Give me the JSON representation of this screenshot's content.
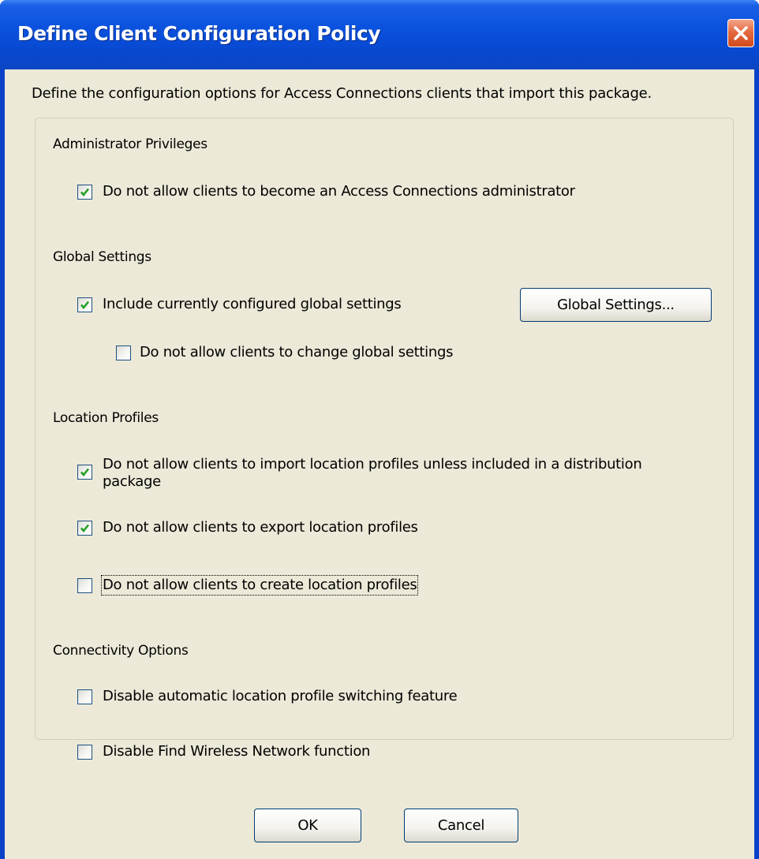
{
  "window": {
    "title": "Define Client Configuration Policy"
  },
  "intro": "Define the configuration options for Access Connections clients that import this package.",
  "sections": {
    "admin": {
      "heading": "Administrator Privileges",
      "no_admin": {
        "label": "Do not allow clients to become an Access Connections administrator",
        "checked": true
      }
    },
    "global": {
      "heading": "Global Settings",
      "include": {
        "label": "Include currently configured global settings",
        "checked": true
      },
      "button_label": "Global Settings...",
      "no_change": {
        "label": "Do not allow clients to change global settings",
        "checked": false
      }
    },
    "location": {
      "heading": "Location Profiles",
      "no_import": {
        "label": "Do not allow clients to import location profiles unless included in a distribution package",
        "checked": true
      },
      "no_export": {
        "label": "Do not allow clients to export location profiles",
        "checked": true
      },
      "no_create": {
        "label": "Do not allow clients to create location profiles",
        "checked": false
      }
    },
    "connectivity": {
      "heading": "Connectivity Options",
      "disable_switching": {
        "label": "Disable automatic location profile switching feature",
        "checked": false
      },
      "disable_find": {
        "label": "Disable Find Wireless Network function",
        "checked": false
      }
    }
  },
  "buttons": {
    "ok": "OK",
    "cancel": "Cancel"
  },
  "colors": {
    "titlebar": "#0a52de",
    "dialog_bg": "#ece9d8",
    "check": "#21a121",
    "close": "#e46a3f"
  }
}
